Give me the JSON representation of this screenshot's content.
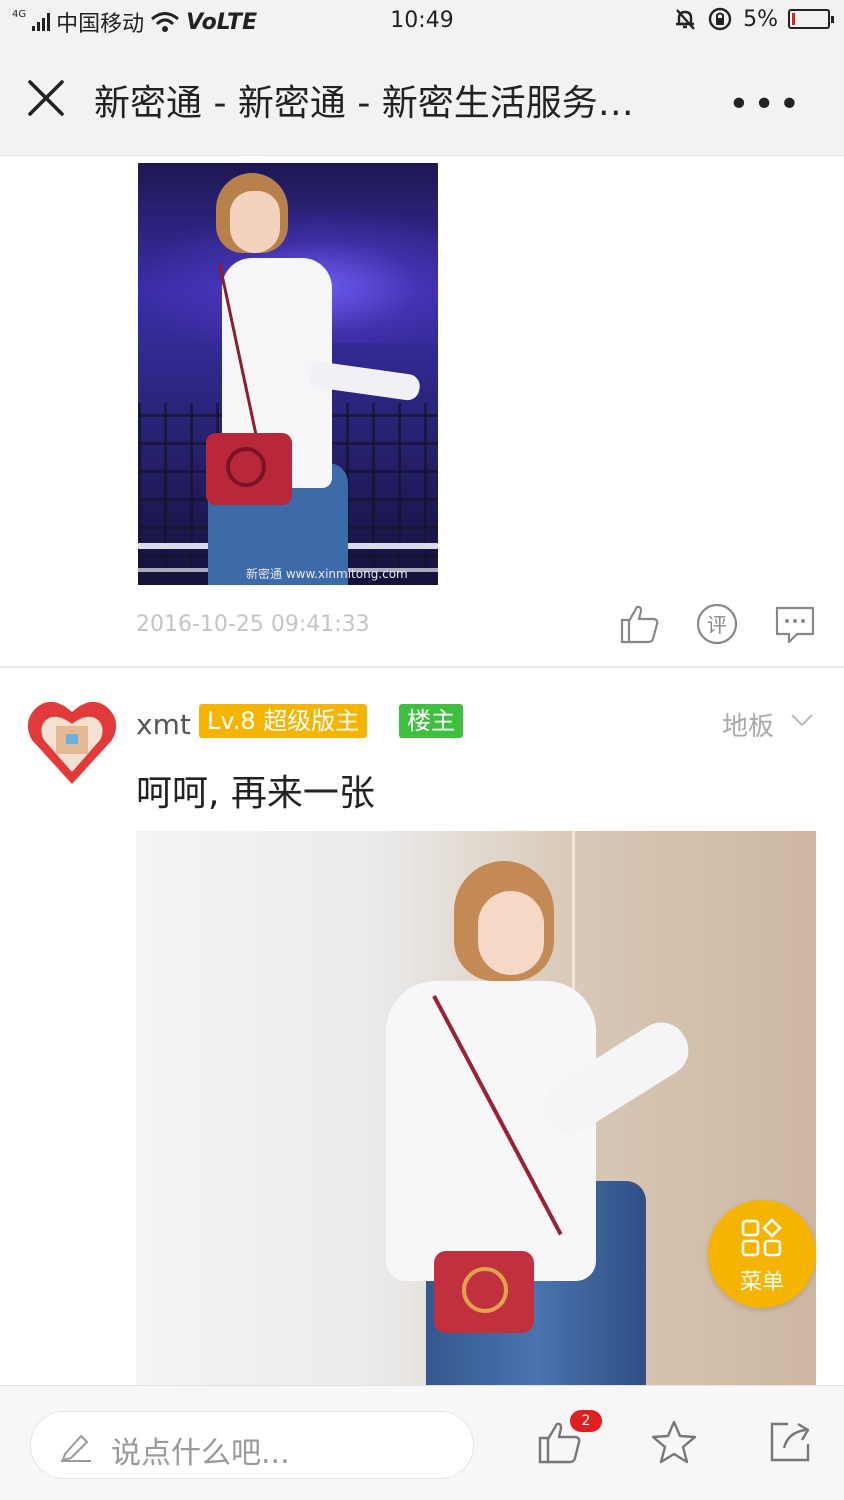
{
  "status_bar": {
    "network": "4G",
    "carrier": "中国移动",
    "volte": "VoLTE",
    "time": "10:49",
    "battery": "5%",
    "battery_level": 0.05
  },
  "nav": {
    "title": "新密通 - 新密通 - 新密生活服务…",
    "more": "•••",
    "close_icon": "close-icon"
  },
  "post1": {
    "watermark": "新密通 www.xinmitong.com",
    "timestamp": "2016-10-25  09:41:33",
    "actions": [
      "thumbs-up-icon",
      "rate-icon",
      "comment-icon"
    ],
    "rate_glyph": "评"
  },
  "post2": {
    "username": "xmt",
    "level_badge": "Lv.8 超级版主",
    "owner_badge": "楼主",
    "floor": "地板",
    "text": "呵呵, 再来一张"
  },
  "fab": {
    "label": "菜单",
    "accent": "#f5b400"
  },
  "bottom_bar": {
    "comment_placeholder": "说点什么吧...",
    "like_count": "2",
    "actions": [
      "thumbs-up-icon",
      "star-icon",
      "share-icon"
    ]
  },
  "colors": {
    "level_badge": "#f5b400",
    "owner_badge": "#3fbf3f",
    "badge_count": "#e02020"
  }
}
